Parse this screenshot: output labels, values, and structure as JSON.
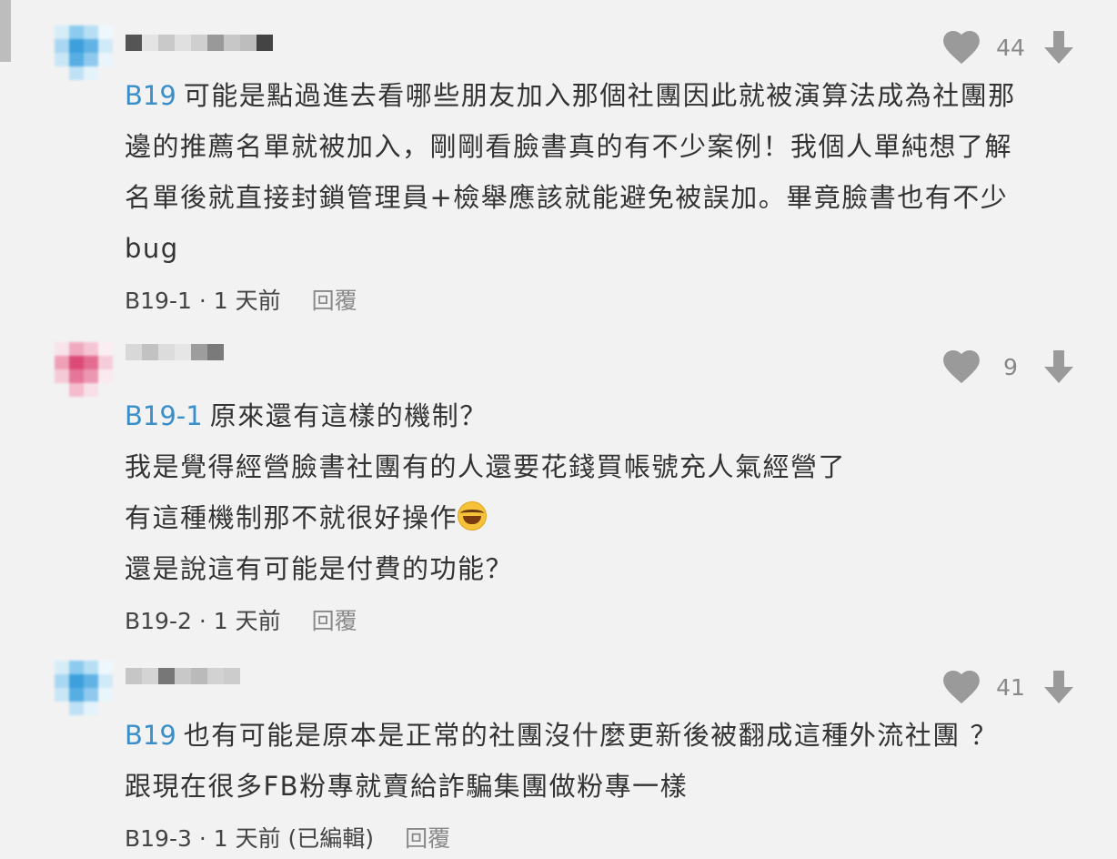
{
  "comments": [
    {
      "likes": "44",
      "text_ref": "B19",
      "lines": [
        "可能是點過進去看哪些朋友加入那個社團因此就被演算法成為社團那",
        "邊的推薦名單就被加入，剛剛看臉書真的有不少案例！我個人單純想了解",
        "名單後就直接封鎖管理員+檢舉應該就能避免被誤加。畢竟臉書也有不少",
        "bug"
      ],
      "floor": "B19-1",
      "time": "1 天前",
      "edited": "",
      "reply_label": "回覆"
    },
    {
      "likes": "9",
      "text_ref": "B19-1",
      "lines": [
        "原來還有這樣的機制？",
        "我是覺得經營臉書社團有的人還要花錢買帳號充人氣經營了",
        "有這種機制那不就很好操作",
        "還是說這有可能是付費的功能？"
      ],
      "floor": "B19-2",
      "time": "1 天前",
      "edited": "",
      "reply_label": "回覆"
    },
    {
      "likes": "41",
      "text_ref": "B19",
      "lines": [
        "也有可能是原本是正常的社團沒什麼更新後被翻成這種外流社團 ？",
        "跟現在很多FB粉專就賣給詐騙集團做粉專一樣"
      ],
      "floor": "B19-3",
      "time": "1 天前",
      "edited": "(已編輯)",
      "reply_label": "回覆"
    }
  ],
  "icons": {
    "like": "heart-icon",
    "dislike": "arrow-down-icon",
    "emoji": "face-with-tears-of-joy-icon"
  },
  "colors": {
    "background": "#f2f2f2",
    "floor_ref": "#3a8fc9",
    "icon_gray": "#9a9a9a"
  }
}
